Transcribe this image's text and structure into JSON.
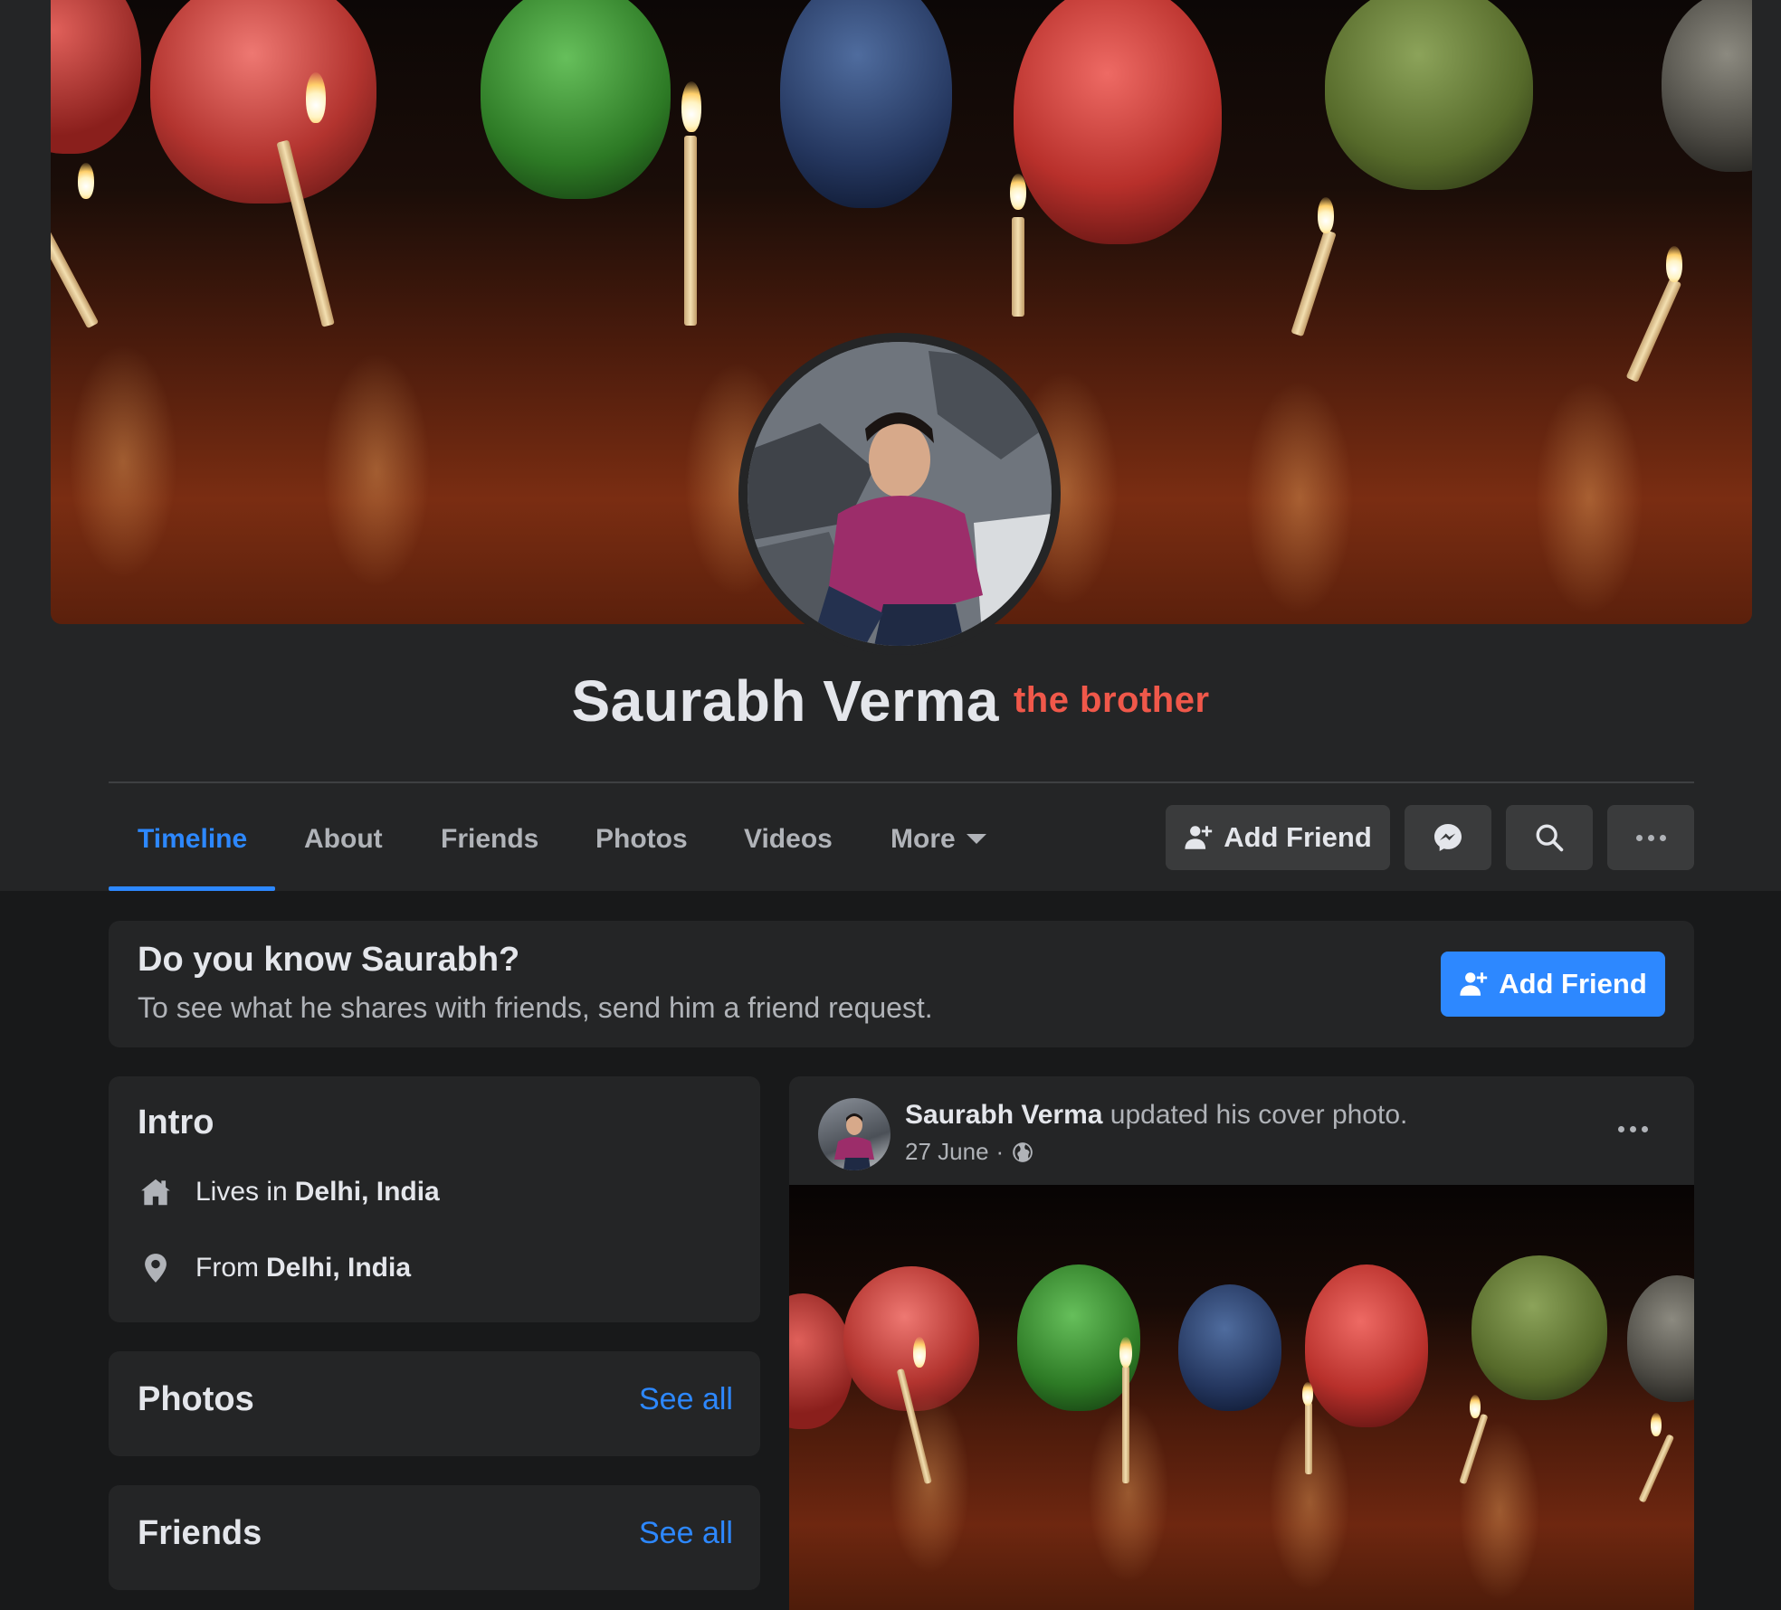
{
  "profile": {
    "name": "Saurabh Verma",
    "nickname": "the brother"
  },
  "tabs": [
    {
      "label": "Timeline",
      "active": true
    },
    {
      "label": "About"
    },
    {
      "label": "Friends"
    },
    {
      "label": "Photos"
    },
    {
      "label": "Videos"
    },
    {
      "label": "More"
    }
  ],
  "actions": {
    "add_friend_label": "Add Friend"
  },
  "know_card": {
    "title": "Do you know Saurabh?",
    "subtitle": "To see what he shares with friends, send him a friend request.",
    "button_label": "Add Friend"
  },
  "intro": {
    "title": "Intro",
    "lives_prefix": "Lives in",
    "lives_place": "Delhi, India",
    "from_prefix": "From",
    "from_place": "Delhi, India"
  },
  "photos_section": {
    "title": "Photos",
    "see_all": "See all"
  },
  "friends_section": {
    "title": "Friends",
    "see_all": "See all"
  },
  "post": {
    "author": "Saurabh Verma",
    "action": "updated his cover photo.",
    "date": "27 June",
    "separator": "·",
    "privacy_icon": "globe-icon"
  },
  "colors": {
    "accent": "#2d88ff",
    "nickname": "#f0584a",
    "surface": "#242526",
    "background": "#18191a"
  }
}
